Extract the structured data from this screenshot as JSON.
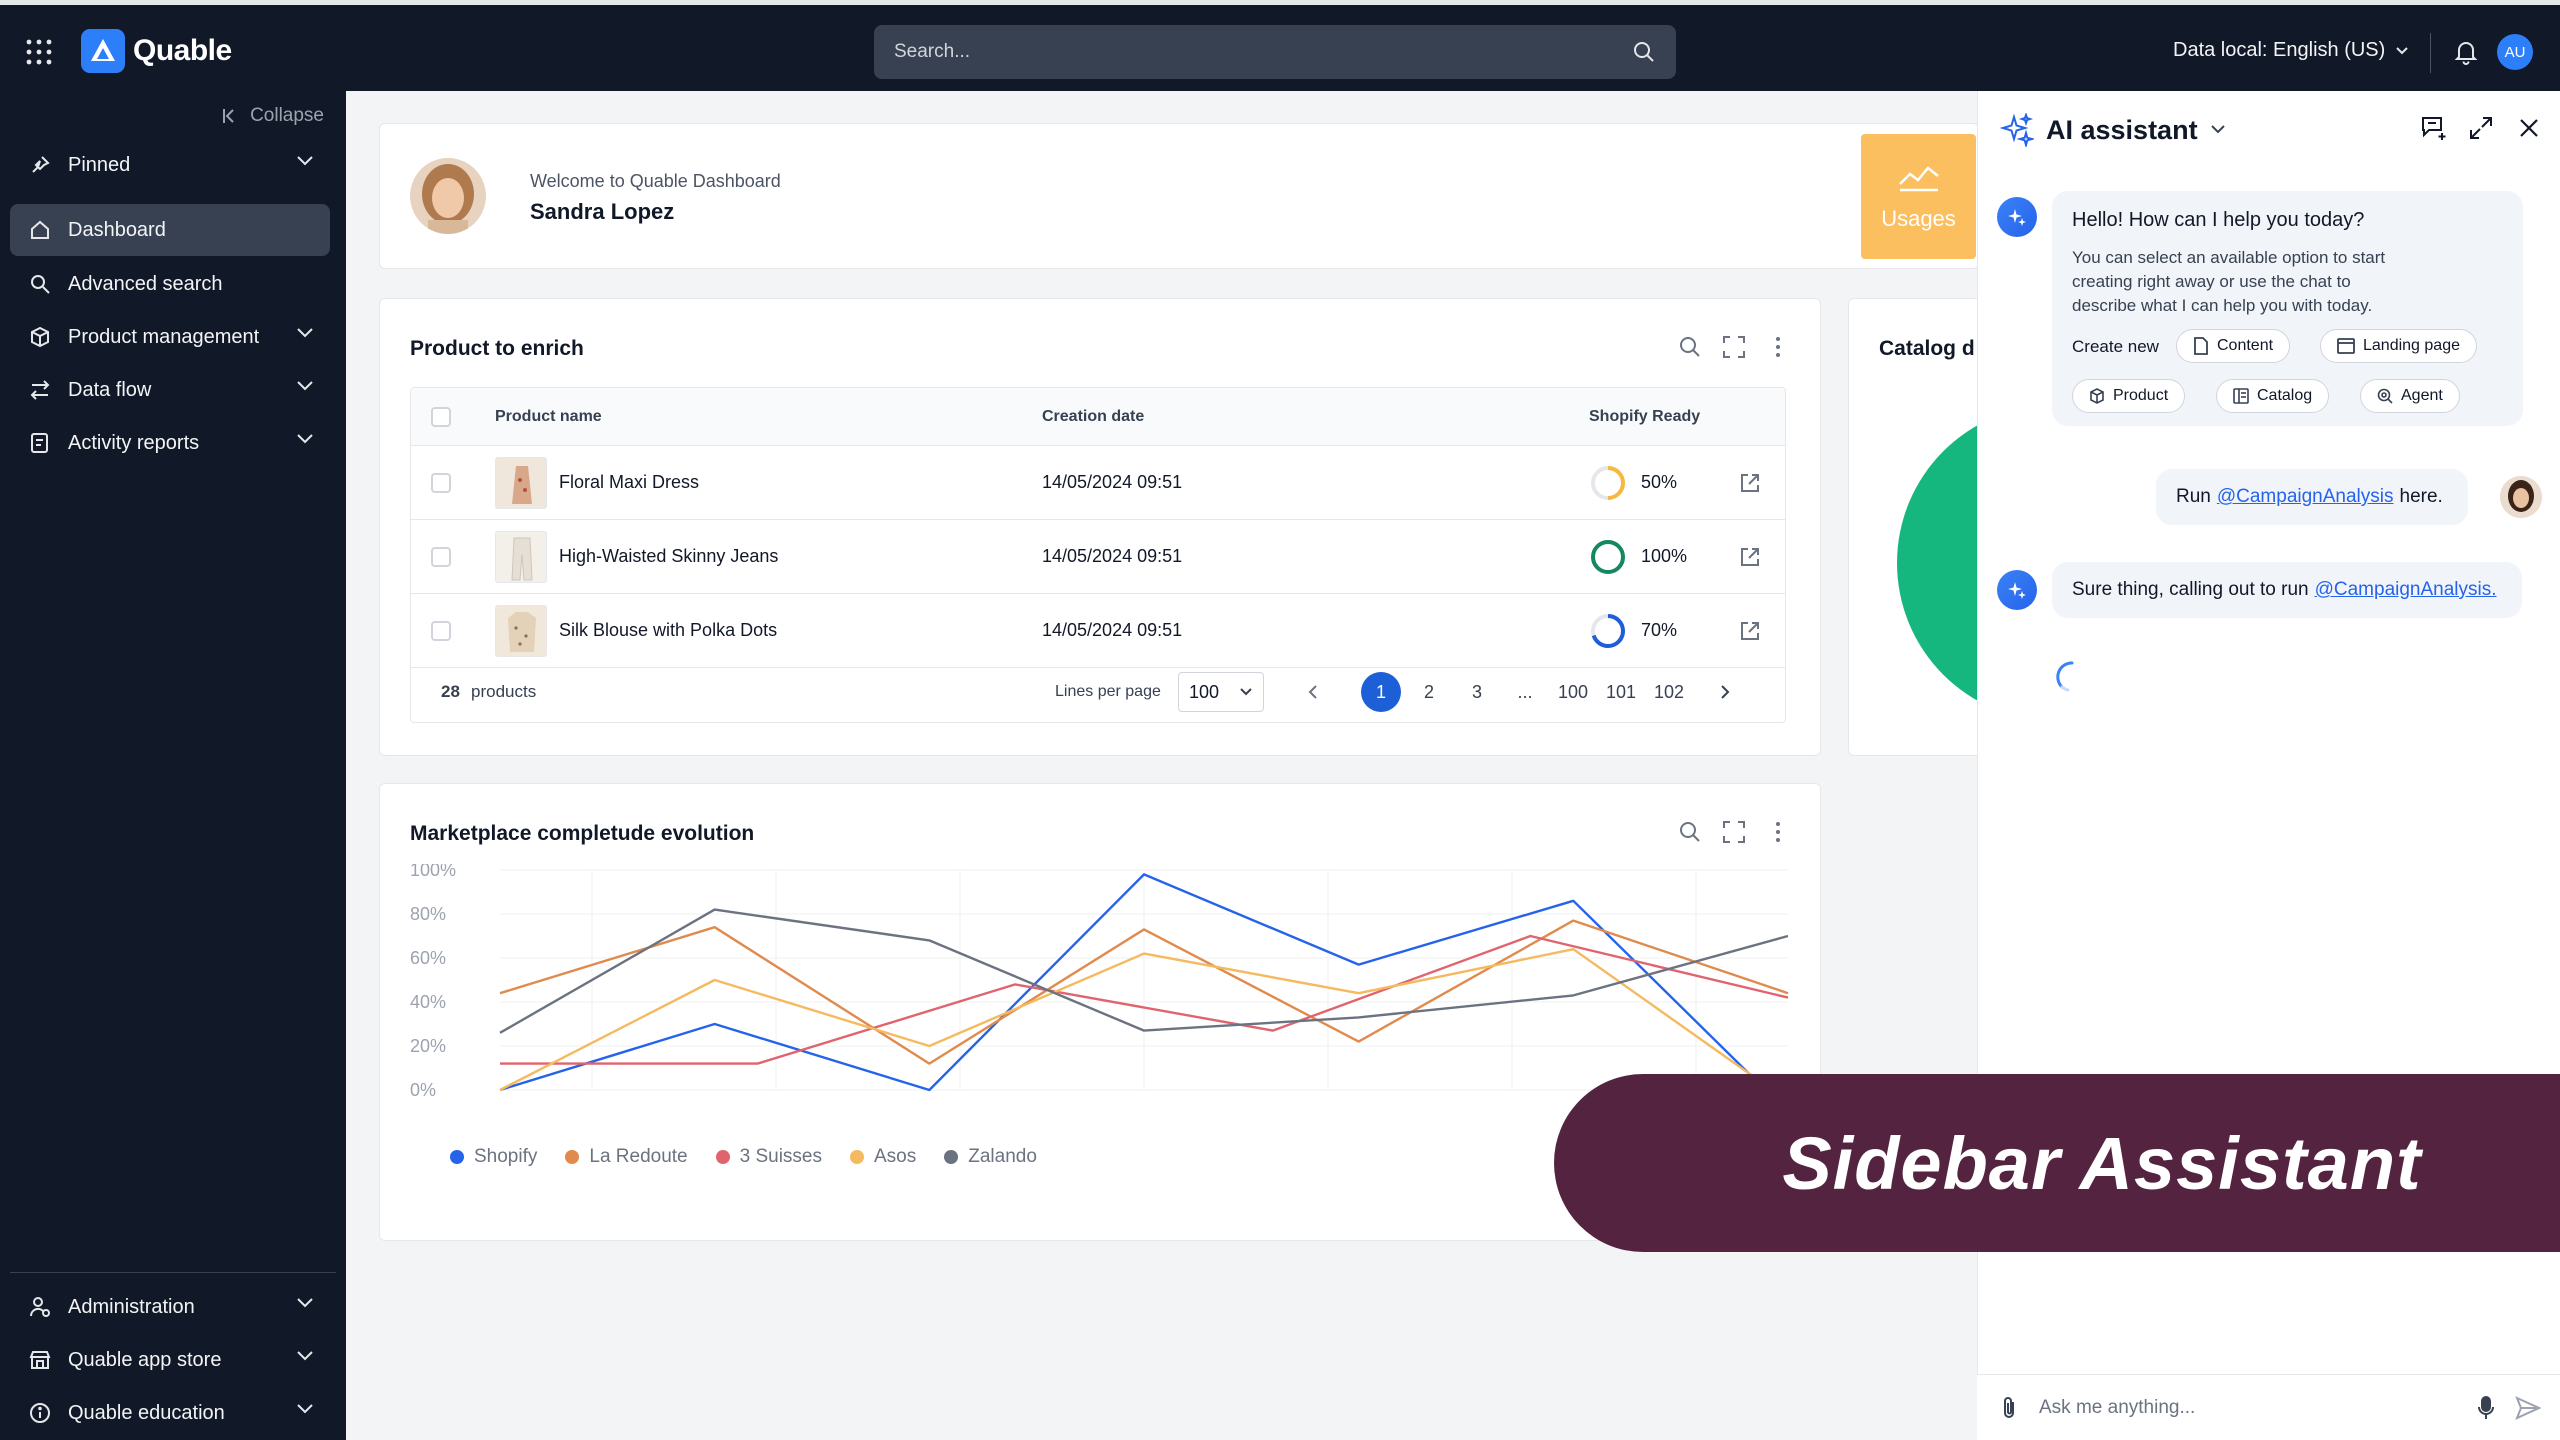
{
  "app": {
    "name": "Quable"
  },
  "search": {
    "placeholder": "Search..."
  },
  "topbar": {
    "language": "Data local: English (US)",
    "user_initials": "AU"
  },
  "sidebar": {
    "collapse_label": "Collapse",
    "items": [
      {
        "label": "Pinned"
      },
      {
        "label": "Dashboard"
      },
      {
        "label": "Advanced search"
      },
      {
        "label": "Product management"
      },
      {
        "label": "Data flow"
      },
      {
        "label": "Activity reports"
      }
    ],
    "bottom_items": [
      {
        "label": "Administration"
      },
      {
        "label": "Quable app store"
      },
      {
        "label": "Quable education"
      }
    ]
  },
  "welcome": {
    "greeting": "Welcome to Quable Dashboard",
    "user_name": "Sandra Lopez",
    "usages_label": "Usages"
  },
  "product_table": {
    "title": "Product to enrich",
    "columns": [
      "Product name",
      "Creation date",
      "Shopify Ready"
    ],
    "rows": [
      {
        "name": "Floral Maxi Dress",
        "date": "14/05/2024 09:51",
        "ready": "50%",
        "pct": 50,
        "color": "#f5b942"
      },
      {
        "name": "High-Waisted Skinny Jeans",
        "date": "14/05/2024 09:51",
        "ready": "100%",
        "pct": 100,
        "color": "#16875e"
      },
      {
        "name": "Silk Blouse with Polka Dots",
        "date": "14/05/2024 09:51",
        "ready": "70%",
        "pct": 70,
        "color": "#1d5fd6"
      }
    ],
    "footer": {
      "count": "28",
      "count_label": "products",
      "lines_label": "Lines per page",
      "lines_value": "100",
      "pages": [
        "1",
        "2",
        "3",
        "...",
        "100",
        "101",
        "102"
      ]
    }
  },
  "catalog_card": {
    "title": "Catalog d"
  },
  "marketplace_chart": {
    "title": "Marketplace completude evolution"
  },
  "chart_data": {
    "type": "line",
    "title": "Marketplace completude evolution",
    "y_ticks": [
      "100%",
      "80%",
      "60%",
      "40%",
      "20%",
      "0%"
    ],
    "ylim": [
      0,
      100
    ],
    "x_count": 8,
    "grid": true,
    "legend_position": "bottom-left",
    "series": [
      {
        "name": "Shopify",
        "color": "#2563eb",
        "values": [
          0,
          30,
          0,
          98,
          57,
          86,
          -10
        ]
      },
      {
        "name": "La Redoute",
        "color": "#e08b4d",
        "values": [
          44,
          74,
          12,
          73,
          22,
          77,
          44
        ]
      },
      {
        "name": "3 Suisses",
        "color": "#e0646e",
        "values": [
          12,
          12,
          48,
          27,
          70,
          42
        ]
      },
      {
        "name": "Asos",
        "color": "#f5b960",
        "values": [
          0,
          50,
          20,
          62,
          44,
          64,
          -5
        ]
      },
      {
        "name": "Zalando",
        "color": "#6b7280",
        "values": [
          26,
          82,
          68,
          27,
          33,
          43,
          70
        ]
      }
    ]
  },
  "ai": {
    "title": "AI assistant",
    "greeting": "Hello! How can I help you today?",
    "intro": "You can select an available option to start creating right away or use the chat to describe what I can help you with today.",
    "create_label": "Create new",
    "chips": [
      "Content",
      "Landing page",
      "Product",
      "Catalog",
      "Agent"
    ],
    "user_msg_prefix": "Run",
    "user_msg_mention": "@CampaignAnalysis",
    "user_msg_suffix": "here.",
    "bot_reply_prefix": "Sure thing, calling out to run",
    "bot_reply_mention": "@CampaignAnalysis.",
    "input_placeholder": "Ask me anything..."
  },
  "banner": {
    "text": "Sidebar Assistant"
  }
}
